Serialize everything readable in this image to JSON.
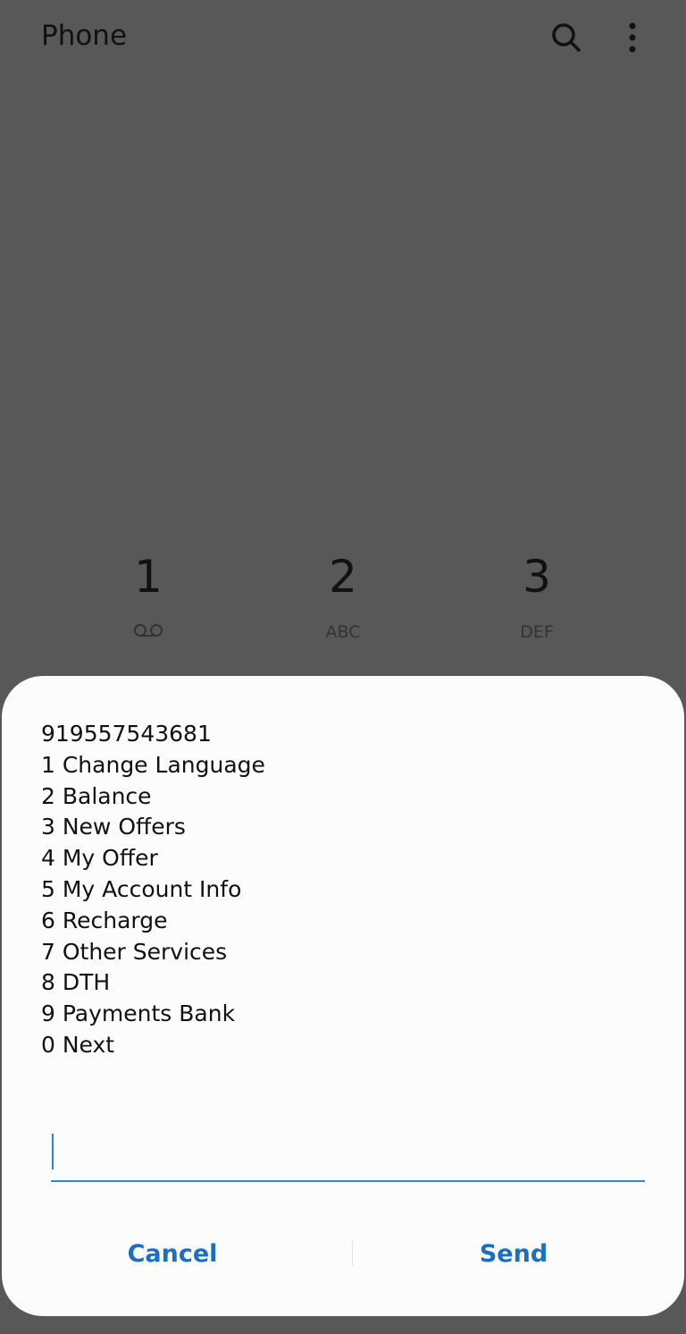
{
  "app_bar": {
    "title": "Phone",
    "icons": [
      "search-icon",
      "more-options-icon"
    ]
  },
  "dialpad": {
    "keys": [
      {
        "digit": "1",
        "letters": "",
        "icon": "voicemail-icon"
      },
      {
        "digit": "2",
        "letters": "ABC"
      },
      {
        "digit": "3",
        "letters": "DEF"
      }
    ]
  },
  "ussd_dialog": {
    "message_lines": [
      "919557543681",
      "1 Change Language",
      "2 Balance",
      "3 New Offers",
      "4 My Offer",
      "5 My Account Info",
      "6 Recharge",
      "7 Other Services",
      "8 DTH",
      "9 Payments Bank",
      "0 Next"
    ],
    "input_value": "",
    "cancel_label": "Cancel",
    "send_label": "Send",
    "accent_color": "#1a6fc4"
  }
}
